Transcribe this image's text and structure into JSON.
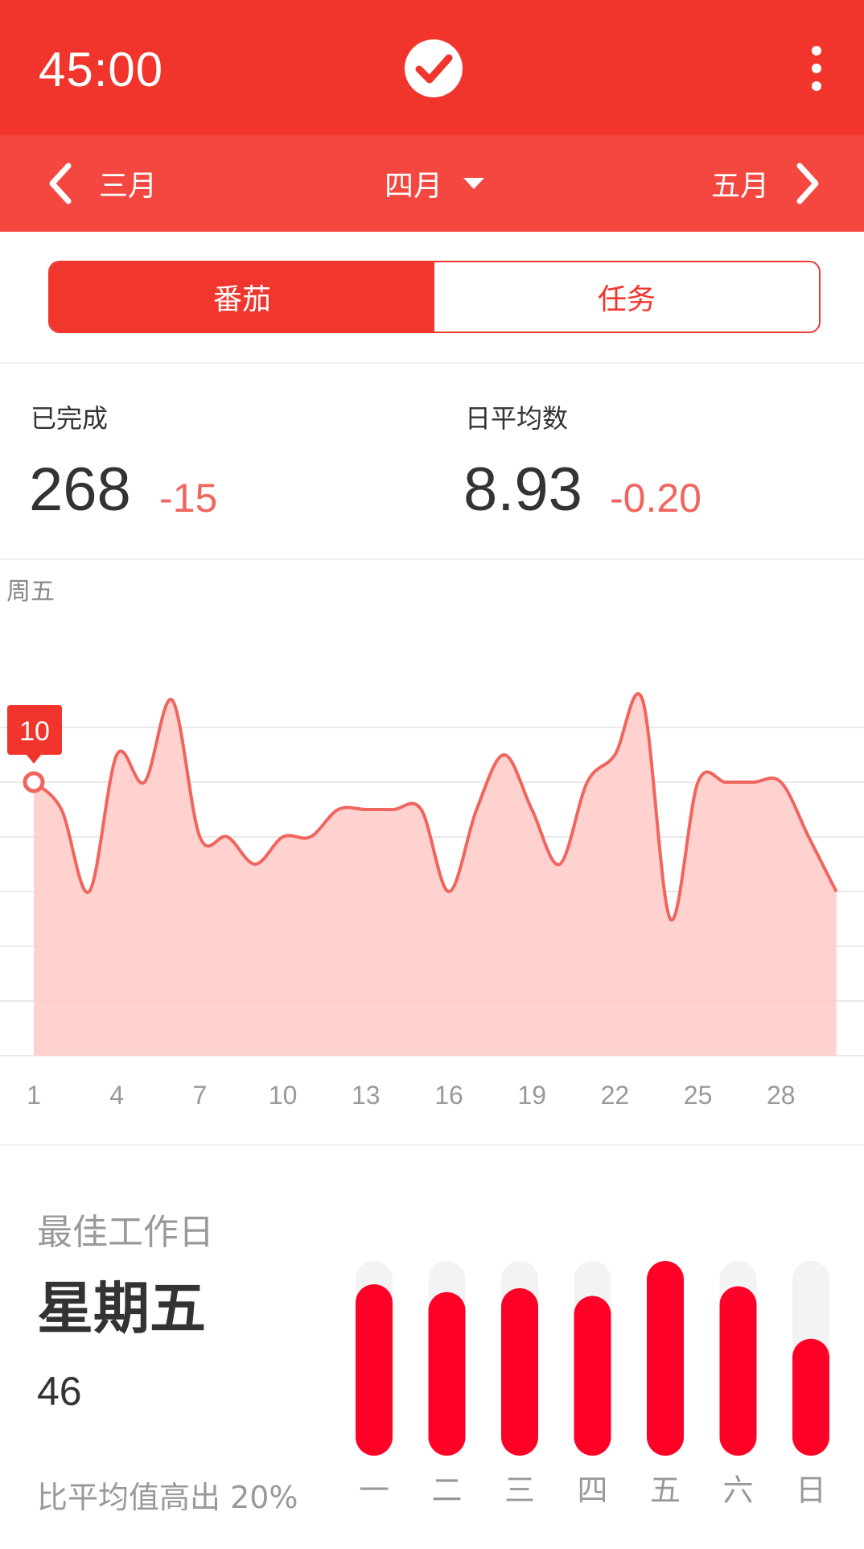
{
  "header": {
    "timer": "45:00",
    "app_icon": "check-circle-icon",
    "menu_icon": "more-vertical-icon",
    "colors": {
      "primary": "#f2352c",
      "secondary": "#f4473f"
    }
  },
  "month_nav": {
    "prev": "三月",
    "current": "四月",
    "next": "五月"
  },
  "segment": {
    "tabs": [
      "番茄",
      "任务"
    ],
    "active": 0
  },
  "stats": {
    "completed_label": "已完成",
    "completed_value": "268",
    "completed_delta": "-15",
    "avg_label": "日平均数",
    "avg_value": "8.93",
    "avg_delta": "-0.20"
  },
  "chart_data": {
    "type": "area",
    "title": "周五",
    "x": [
      1,
      2,
      3,
      4,
      5,
      6,
      7,
      8,
      9,
      10,
      11,
      12,
      13,
      14,
      15,
      16,
      17,
      18,
      19,
      20,
      21,
      22,
      23,
      24,
      25,
      26,
      27,
      28,
      29,
      30
    ],
    "values": [
      10,
      9,
      6,
      11,
      10,
      13,
      8,
      8,
      7,
      8,
      8,
      9,
      9,
      9,
      9,
      6,
      9,
      11,
      9,
      7,
      10,
      11,
      13,
      5,
      10,
      10,
      10,
      10,
      8,
      6
    ],
    "ylim": [
      0,
      14
    ],
    "x_tick_labels": [
      "1",
      "4",
      "7",
      "10",
      "13",
      "16",
      "19",
      "22",
      "25",
      "28"
    ],
    "highlight": {
      "day": 1,
      "value": "10"
    },
    "color": "#f0655e",
    "fill": "#ffc9c7",
    "grid": true
  },
  "best_day": {
    "title": "最佳工作日",
    "day": "星期五",
    "count": "46",
    "note": "比平均值高出 20%",
    "weekdays": [
      "一",
      "二",
      "三",
      "四",
      "五",
      "六",
      "日"
    ],
    "fractions": [
      0.88,
      0.84,
      0.86,
      0.82,
      1.0,
      0.87,
      0.6
    ],
    "bar_color": "#ff0026",
    "track_color": "#f3f3f3"
  }
}
